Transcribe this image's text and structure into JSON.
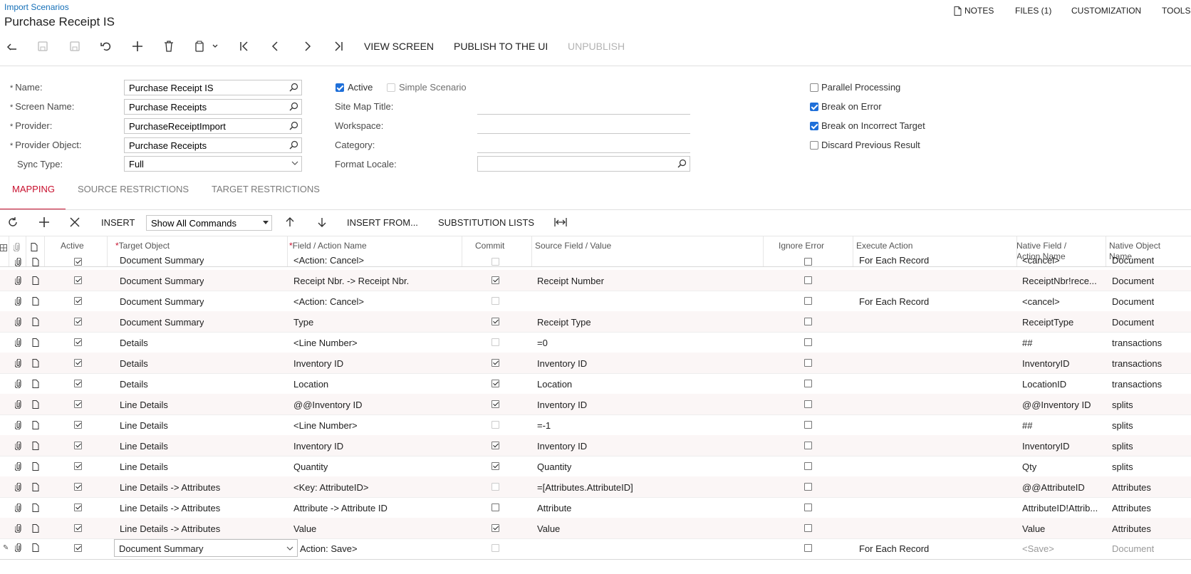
{
  "breadcrumb": "Import Scenarios",
  "title": "Purchase Receipt IS",
  "top_links": {
    "notes": "NOTES",
    "files": "FILES (1)",
    "customization": "CUSTOMIZATION",
    "tools": "TOOLS"
  },
  "toolbar": {
    "view_screen": "VIEW SCREEN",
    "publish": "PUBLISH TO THE UI",
    "unpublish": "UNPUBLISH"
  },
  "form": {
    "name_label": "Name:",
    "name_value": "Purchase Receipt IS",
    "screen_name_label": "Screen Name:",
    "screen_name_value": "Purchase Receipts",
    "provider_label": "Provider:",
    "provider_value": "PurchaseReceiptImport",
    "provider_object_label": "Provider Object:",
    "provider_object_value": "Purchase Receipts",
    "sync_type_label": "Sync Type:",
    "sync_type_value": "Full",
    "active_label": "Active",
    "active_checked": true,
    "simple_label": "Simple Scenario",
    "simple_checked": false,
    "site_map_label": "Site Map Title:",
    "workspace_label": "Workspace:",
    "category_label": "Category:",
    "format_locale_label": "Format Locale:",
    "parallel_label": "Parallel Processing",
    "parallel_checked": false,
    "break_error_label": "Break on Error",
    "break_error_checked": true,
    "break_target_label": "Break on Incorrect Target",
    "break_target_checked": true,
    "discard_label": "Discard Previous Result",
    "discard_checked": false
  },
  "tabs": {
    "mapping": "MAPPING",
    "source": "SOURCE RESTRICTIONS",
    "target": "TARGET RESTRICTIONS"
  },
  "grid_toolbar": {
    "insert": "INSERT",
    "filter_value": "Show All Commands",
    "insert_from": "INSERT FROM...",
    "substitution": "SUBSTITUTION LISTS"
  },
  "columns": {
    "active": "Active",
    "target": "Target Object",
    "field": "Field / Action Name",
    "commit": "Commit",
    "source": "Source Field / Value",
    "ignore": "Ignore Error",
    "execute": "Execute Action",
    "native_field": "Native Field / Action Name",
    "native_object": "Native Object Name"
  },
  "rows": [
    {
      "target": "Document Summary",
      "field": "<Action: Cancel>",
      "commit": "dis",
      "source": "",
      "execute": "For Each Record",
      "native_field": "<cancel>",
      "native_object": "Document"
    },
    {
      "target": "Document Summary",
      "field": "Receipt Nbr. -> Receipt Nbr.",
      "commit": "on",
      "source": "Receipt Number",
      "execute": "",
      "native_field": "ReceiptNbr!rece...",
      "native_object": "Document"
    },
    {
      "target": "Document Summary",
      "field": "<Action: Cancel>",
      "commit": "dis",
      "source": "",
      "execute": "For Each Record",
      "native_field": "<cancel>",
      "native_object": "Document"
    },
    {
      "target": "Document Summary",
      "field": "Type",
      "commit": "on",
      "source": "Receipt Type",
      "execute": "",
      "native_field": "ReceiptType",
      "native_object": "Document"
    },
    {
      "target": "Details",
      "field": "<Line Number>",
      "commit": "dis",
      "source": "=0",
      "execute": "",
      "native_field": "##",
      "native_object": "transactions"
    },
    {
      "target": "Details",
      "field": "Inventory ID",
      "commit": "on",
      "source": "Inventory ID",
      "execute": "",
      "native_field": "InventoryID",
      "native_object": "transactions"
    },
    {
      "target": "Details",
      "field": "Location",
      "commit": "on",
      "source": "Location",
      "execute": "",
      "native_field": "LocationID",
      "native_object": "transactions"
    },
    {
      "target": "Line Details",
      "field": "@@Inventory ID",
      "commit": "on",
      "source": "Inventory ID",
      "execute": "",
      "native_field": "@@Inventory ID",
      "native_object": "splits"
    },
    {
      "target": "Line Details",
      "field": "<Line Number>",
      "commit": "dis",
      "source": "=-1",
      "execute": "",
      "native_field": "##",
      "native_object": "splits"
    },
    {
      "target": "Line Details",
      "field": "Inventory ID",
      "commit": "on",
      "source": "Inventory ID",
      "execute": "",
      "native_field": "InventoryID",
      "native_object": "splits"
    },
    {
      "target": "Line Details",
      "field": "Quantity",
      "commit": "on",
      "source": "Quantity",
      "execute": "",
      "native_field": "Qty",
      "native_object": "splits"
    },
    {
      "target": "Line Details -> Attributes",
      "field": "<Key: AttributeID>",
      "commit": "dis",
      "source": "=[Attributes.AttributeID]",
      "execute": "",
      "native_field": "@@AttributeID",
      "native_object": "Attributes"
    },
    {
      "target": "Line Details -> Attributes",
      "field": "Attribute -> Attribute ID",
      "commit": "off",
      "source": "Attribute",
      "execute": "",
      "native_field": "AttributeID!Attrib...",
      "native_object": "Attributes"
    },
    {
      "target": "Line Details -> Attributes",
      "field": "Value",
      "commit": "on",
      "source": "Value",
      "execute": "",
      "native_field": "Value",
      "native_object": "Attributes"
    }
  ],
  "edit_row": {
    "target": "Document Summary",
    "field": "Action: Save>",
    "execute": "For Each Record",
    "native_field": "<Save>",
    "native_object": "Document"
  }
}
